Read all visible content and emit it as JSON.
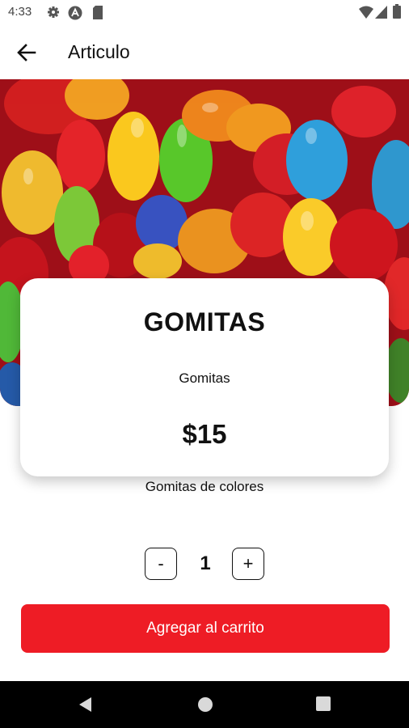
{
  "status_bar": {
    "time": "4:33"
  },
  "header": {
    "title": "Articulo"
  },
  "product": {
    "name": "GOMITAS",
    "subtitle": "Gomitas",
    "price": "$15",
    "description": "Gomitas de colores"
  },
  "stepper": {
    "minus_label": "-",
    "quantity": "1",
    "plus_label": "+"
  },
  "actions": {
    "add_to_cart": "Agregar al carrito"
  },
  "colors": {
    "accent": "#ee1c25",
    "card": "#ffffff",
    "navbar": "#000000"
  },
  "icons": {
    "status": [
      "settings-icon",
      "a-icon",
      "sd-card-icon",
      "wifi-icon",
      "signal-icon",
      "battery-icon"
    ],
    "header": "arrow-back-icon",
    "nav": [
      "nav-back-icon",
      "nav-home-icon",
      "nav-recents-icon"
    ]
  }
}
